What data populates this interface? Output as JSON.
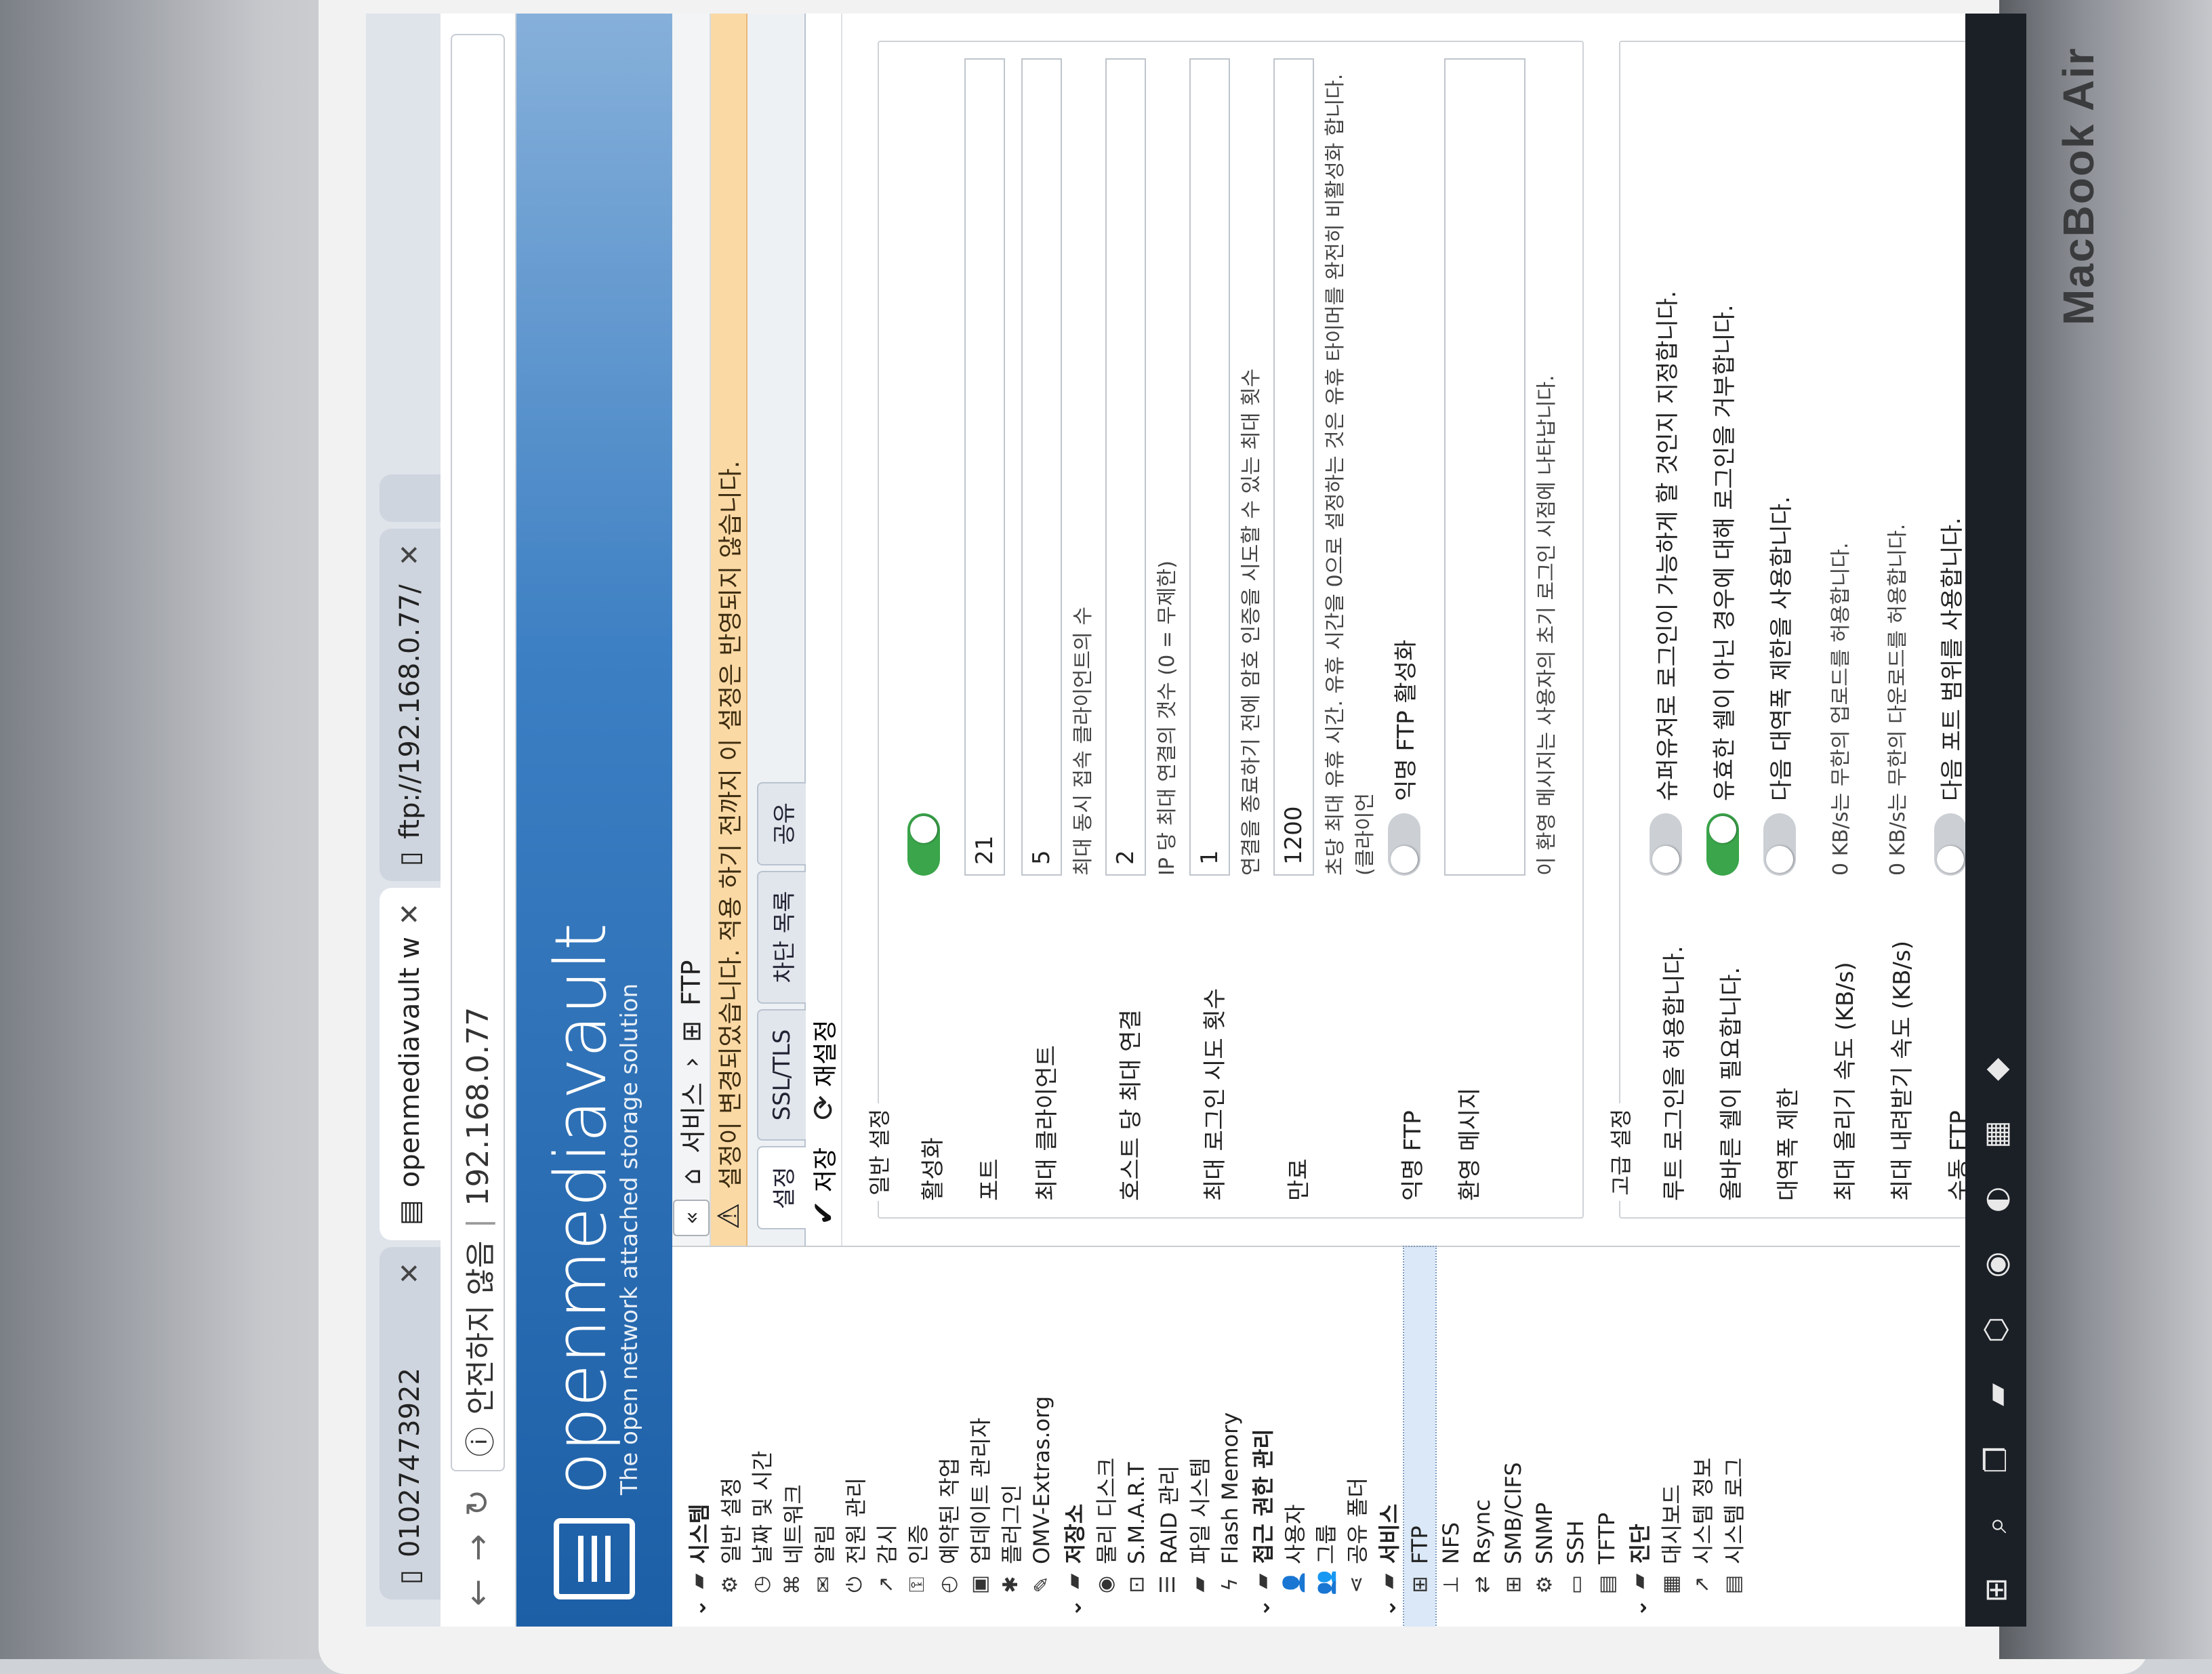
{
  "device": {
    "brand": "MacBook Air"
  },
  "browser": {
    "tabs": [
      {
        "title": "01027473922",
        "active": false
      },
      {
        "title": "openmediavault web ad",
        "active": true
      },
      {
        "title": "ftp://192.168.0.77/",
        "active": false
      }
    ],
    "address": {
      "security": "안전하지 않음",
      "url": "192.168.0.77"
    }
  },
  "app": {
    "name": "openmediavault",
    "tagline": "The open network attached storage solution"
  },
  "sidebar": {
    "groups": [
      {
        "label": "시스템",
        "items": [
          {
            "label": "일반 설정",
            "icon": "gears-icon"
          },
          {
            "label": "날짜 및 시간",
            "icon": "clock-icon"
          },
          {
            "label": "네트워크",
            "icon": "network-icon"
          },
          {
            "label": "알림",
            "icon": "mail-icon"
          },
          {
            "label": "전원 관리",
            "icon": "power-icon"
          },
          {
            "label": "감시",
            "icon": "chart-icon"
          },
          {
            "label": "인증",
            "icon": "key-icon"
          },
          {
            "label": "예약된 작업",
            "icon": "clock-icon"
          },
          {
            "label": "업데이트 관리자",
            "icon": "update-icon"
          },
          {
            "label": "플러그인",
            "icon": "puzzle-icon"
          },
          {
            "label": "OMV-Extras.org",
            "icon": "wrench-icon"
          }
        ]
      },
      {
        "label": "저장소",
        "items": [
          {
            "label": "물리 디스크",
            "icon": "disk-icon"
          },
          {
            "label": "S.M.A.R.T",
            "icon": "smart-icon"
          },
          {
            "label": "RAID 관리",
            "icon": "raid-icon"
          },
          {
            "label": "파일 시스템",
            "icon": "folder-icon"
          },
          {
            "label": "Flash Memory",
            "icon": "flash-icon"
          }
        ]
      },
      {
        "label": "접근 권한 관리",
        "items": [
          {
            "label": "사용자",
            "icon": "user-icon"
          },
          {
            "label": "그룹",
            "icon": "group-icon"
          },
          {
            "label": "공유 폴더",
            "icon": "share-icon"
          }
        ]
      },
      {
        "label": "서비스",
        "items": [
          {
            "label": "FTP",
            "icon": "ftp-icon",
            "selected": true
          },
          {
            "label": "NFS",
            "icon": "nfs-icon"
          },
          {
            "label": "Rsync",
            "icon": "rsync-icon"
          },
          {
            "label": "SMB/CIFS",
            "icon": "windows-icon"
          },
          {
            "label": "SNMP",
            "icon": "gear-icon"
          },
          {
            "label": "SSH",
            "icon": "terminal-icon"
          },
          {
            "label": "TFTP",
            "icon": "tftp-icon"
          }
        ]
      },
      {
        "label": "진단",
        "items": [
          {
            "label": "대시보드",
            "icon": "dashboard-icon"
          },
          {
            "label": "시스템 정보",
            "icon": "chart-icon"
          },
          {
            "label": "시스템 로그",
            "icon": "log-icon"
          }
        ]
      }
    ]
  },
  "breadcrumb": {
    "parent": "서비스",
    "current": "FTP"
  },
  "warning": "설정이 변경되었습니다. 적용 하기 전까지 이 설정은 반영되지 않습니다.",
  "tabs": [
    "설정",
    "SSL/TLS",
    "차단 목록",
    "공유"
  ],
  "toolbar": {
    "save": "저장",
    "reset": "재설정"
  },
  "form": {
    "section_general": "일반 설정",
    "enable_label": "활성화",
    "enable_on": true,
    "port_label": "포트",
    "port_value": "21",
    "max_clients_label": "최대 클라이언트",
    "max_clients_value": "5",
    "max_clients_hint": "최대 동시 접속 클라이언트의 수",
    "max_conn_host_label": "호스트 당 최대 연결",
    "max_conn_host_value": "2",
    "max_conn_host_hint": "IP 당 최대 연결의 갯수 (0 = 무제한)",
    "max_login_label": "최대 로그인 시도 횟수",
    "max_login_value": "1",
    "max_login_hint": "연결을 종료하기 전에 암호 인증을 시도할 수 있는 최대 횟수",
    "timeout_label": "만료",
    "timeout_value": "1200",
    "timeout_hint": "초당 최대 유휴 시간. 유휴 시간을 0으로 설정하는 것은 유휴 타이머를 완전히 비활성화 합니다. (클라이언",
    "anon_label": "익명 FTP",
    "anon_text": "익명 FTP 활성화",
    "welcome_label": "환영 메시지",
    "welcome_hint": "이 환영 메시지는 사용자의 초기 로그인 시점에 나타납니다.",
    "section_advanced": "고급 설정",
    "root_login_label": "루트 로그인을 허용합니다.",
    "root_login_text": "슈퍼유저로 로그인이 가능하게 할 것인지 지정합니다.",
    "valid_shell_label": "올바른 쉘이 필요합니다.",
    "valid_shell_text": "유효한 쉘이 아닌 경우에 대해 로그인을 거부합니다.",
    "bandwidth_label": "대역폭 제한",
    "bandwidth_text": "다음 대역폭 제한을 사용합니다.",
    "upload_label": "최대 올리기 속도 (KB/s)",
    "upload_hint": "0 KB/s는 무한의 업로드를 허용합니다.",
    "download_label": "최대 내려받기 속도 (KB/s)",
    "download_hint": "0 KB/s는 무한의 다운로드를 허용합니다.",
    "passive_label": "수동 FTP",
    "passive_text": "다음 포트 범위를 사용합니다."
  }
}
